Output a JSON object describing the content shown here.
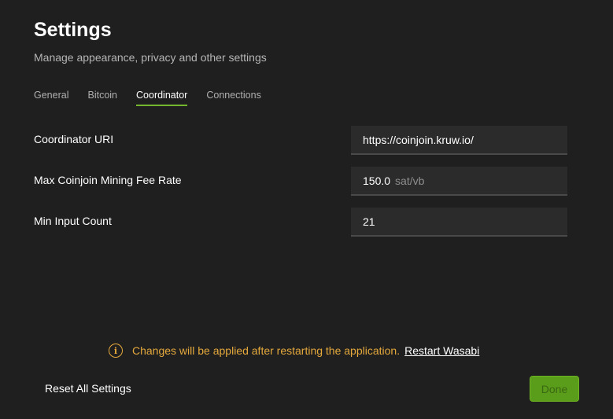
{
  "header": {
    "title": "Settings",
    "subtitle": "Manage appearance, privacy and other settings"
  },
  "tabs": [
    {
      "label": "General",
      "active": false
    },
    {
      "label": "Bitcoin",
      "active": false
    },
    {
      "label": "Coordinator",
      "active": true
    },
    {
      "label": "Connections",
      "active": false
    }
  ],
  "form": {
    "coordinator_uri": {
      "label": "Coordinator URI",
      "value": "https://coinjoin.kruw.io/"
    },
    "max_fee_rate": {
      "label": "Max Coinjoin Mining Fee Rate",
      "value": "150.0",
      "unit": "sat/vb"
    },
    "min_input_count": {
      "label": "Min Input Count",
      "value": "21"
    }
  },
  "notice": {
    "icon": "info-icon",
    "text": "Changes will be applied after restarting the application.",
    "link": "Restart Wasabi"
  },
  "footer": {
    "reset_label": "Reset All Settings",
    "done_label": "Done"
  },
  "colors": {
    "accent": "#74b72e",
    "warning": "#e5a93c",
    "background": "#1f1f1f"
  }
}
